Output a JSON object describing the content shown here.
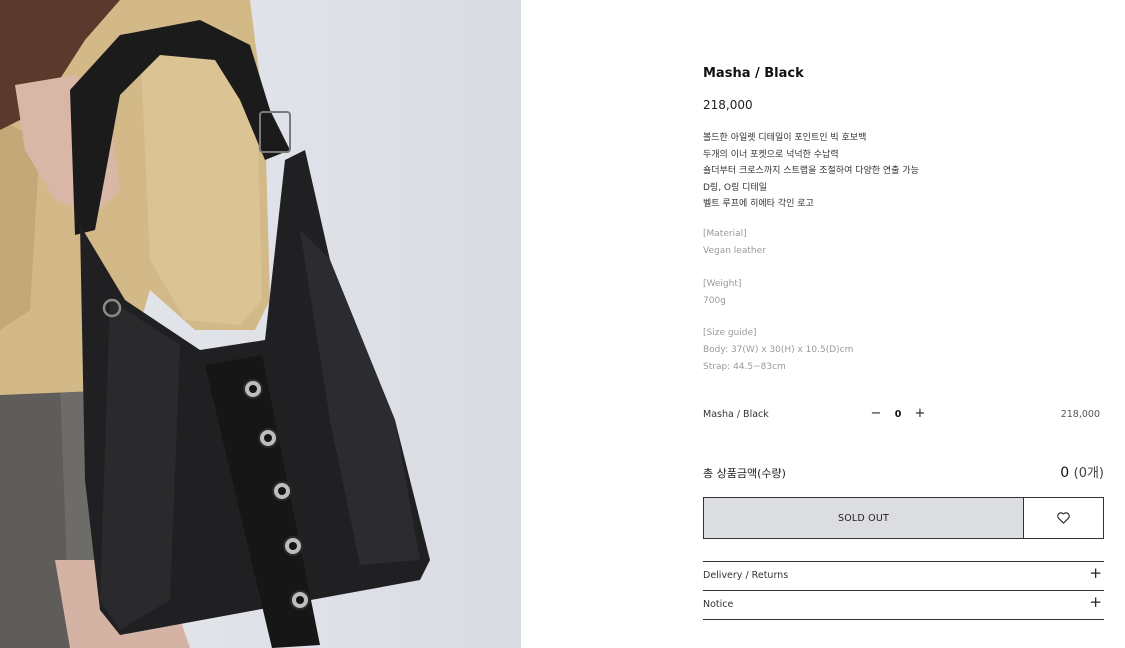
{
  "product": {
    "image_alt": "model wearing black hobo bag",
    "title": "Masha / Black",
    "price": "218,000",
    "description": [
      "볼드한 아일렛 디테일이 포인트인 빅 호보백",
      "두개의 이너 포켓으로 넉넉한 수납력",
      "숄더부터 크로스까지 스트랩을 조절하여 다양한 연출 가능",
      "D링, O링 디테일",
      "벨트 루프에 히에타 각인 로고"
    ],
    "material": {
      "heading": "[Material]",
      "value": "Vegan leather"
    },
    "weight": {
      "heading": "[Weight]",
      "value": "700g"
    },
    "size_guide": {
      "heading": "[Size guide]",
      "body": "Body: 37(W) x  30(H) x 10.5(D)cm",
      "strap": "Strap: 44.5~83cm"
    }
  },
  "option": {
    "name": "Masha / Black",
    "minus_icon": "minus-icon",
    "quantity": "0",
    "plus_icon": "plus-icon",
    "price": "218,000"
  },
  "total": {
    "label": "총 상품금액(수량)",
    "amount": "0",
    "count": "(0개)"
  },
  "actions": {
    "sold_out_label": "SOLD OUT",
    "wish_icon": "heart-icon"
  },
  "accordions": [
    {
      "label": "Delivery / Returns",
      "icon": "plus-icon"
    },
    {
      "label": "Notice",
      "icon": "plus-icon"
    }
  ],
  "colors": {
    "button_bg": "#dcdde1",
    "border": "#333333",
    "muted_text": "#9a9a9a"
  }
}
